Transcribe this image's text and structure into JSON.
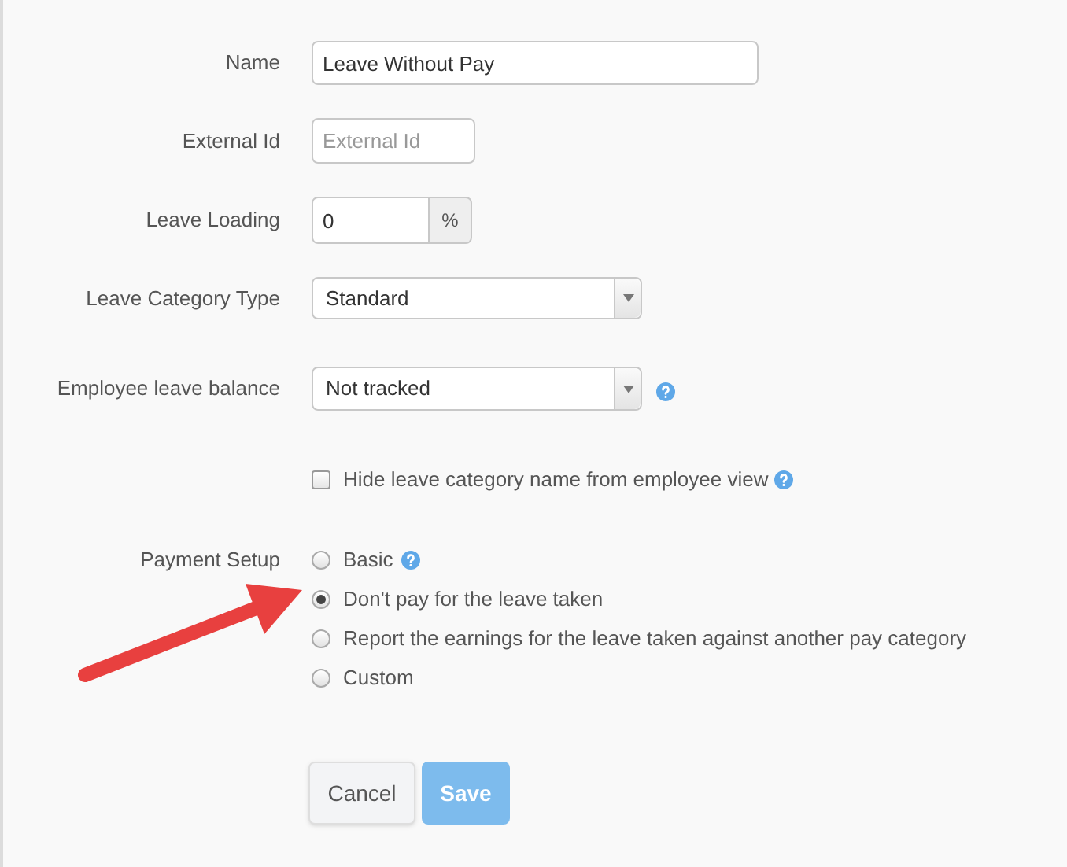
{
  "form": {
    "name": {
      "label": "Name",
      "value": "Leave Without Pay"
    },
    "external_id": {
      "label": "External Id",
      "placeholder": "External Id"
    },
    "leave_loading": {
      "label": "Leave Loading",
      "value": "0",
      "addon": "%"
    },
    "leave_category_type": {
      "label": "Leave Category Type",
      "value": "Standard"
    },
    "employee_leave_balance": {
      "label": "Employee leave balance",
      "value": "Not tracked"
    },
    "hide_name": {
      "label": "Hide leave category name from employee view",
      "checked": false
    },
    "payment_setup": {
      "label": "Payment Setup",
      "options": [
        {
          "label": "Basic",
          "selected": false,
          "help": true
        },
        {
          "label": "Don't pay for the leave taken",
          "selected": true,
          "help": false
        },
        {
          "label": "Report the earnings for the leave taken against another pay category",
          "selected": false,
          "help": false
        },
        {
          "label": "Custom",
          "selected": false,
          "help": false
        }
      ]
    }
  },
  "buttons": [
    {
      "label": "Cancel",
      "kind": "secondary",
      "disabled": false
    },
    {
      "label": "Save",
      "kind": "primary",
      "disabled": true
    }
  ]
}
